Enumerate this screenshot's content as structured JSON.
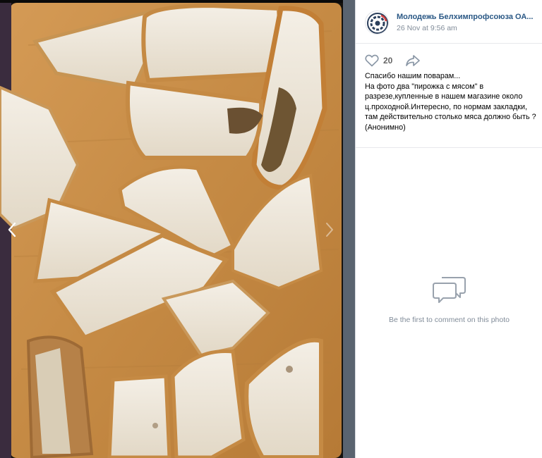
{
  "viewer": {
    "photo_description_icon": "photo",
    "prev_icon": "chevron-left-icon",
    "next_icon": "chevron-right-icon"
  },
  "post": {
    "group_name": "Молодежь Белхимпрофсоюза ОА...",
    "date": "26 Nov at 9:56 am",
    "likes": "20",
    "text": "Спасибо нашим поварам...\nНа фото два \"пирожка с мясом\" в разрезе,купленные в нашем магазине около ц.проходной.Интересно, по нормам закладки, там действительно столько мяса должно быть ?(Анонимно)"
  },
  "comments": {
    "empty_text": "Be the first to comment on this photo"
  },
  "colors": {
    "link": "#2a5885",
    "muted": "#818c99",
    "board": "#c8904a"
  }
}
